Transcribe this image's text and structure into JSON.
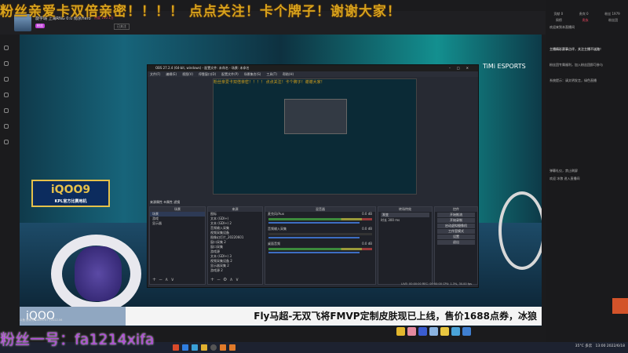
{
  "banner": "粉丝亲爱卡双倍亲密！！！！ 点点关注！卡个牌子！谢谢大家！",
  "header": {
    "streamer": "旋学璐 上海RNG 0:0 南京Hero",
    "hot": "热度 140.1万",
    "fans_badge": "粉丝",
    "subscribe": "已关注"
  },
  "sidebar": {
    "icons": [
      "home-icon",
      "follow-icon",
      "category-icon",
      "game-icon",
      "live-icon",
      "video-icon",
      "more-icon"
    ]
  },
  "video": {
    "sponsor": "iQOO9",
    "sponsor_sub": "KPL官方比赛用机",
    "esports_logo": "TiMi ESPORTS",
    "ticker": "Fly马超-无双飞将FMVP定制皮肤现已上线，售价1688点券，冰狼",
    "iqoo_corner": "iQOO",
    "room_info": "斗鱼 房间号: 1863767 | 2022.06"
  },
  "obs": {
    "title": "OBS 27.2.4 (64-bit, windows) - 配置文件: 未命名 - 场景: 未命名",
    "menu": [
      "文件(F)",
      "编辑(E)",
      "视图(V)",
      "停靠窗口(D)",
      "配置文件(P)",
      "场景集合(S)",
      "工具(T)",
      "帮助(H)"
    ],
    "scene_bar": "来源属性   ⚙属性   滤镜",
    "docks": {
      "scenes": "场景",
      "sources": "来源",
      "mixer": "混音器",
      "transitions": "转场特效",
      "controls": "控件"
    },
    "scenes": [
      "场景",
      "游戏",
      "显示器"
    ],
    "sources": [
      "图标",
      "文本 (GDI+)",
      "文本 (GDI+) 2",
      "音频输入采集",
      "视频采集设备",
      "图像幻灯片_20220601",
      "窗口采集 2",
      "窗口采集",
      "游戏源",
      "文本 (GDI+) 3",
      "视频采集设备 2",
      "显示器采集 2",
      "游戏源 2"
    ],
    "mixer": [
      {
        "name": "麦克风/Aux",
        "db": "0.0 dB"
      },
      {
        "name": "音频输入采集",
        "db": "0.0 dB"
      },
      {
        "name": "桌面音频",
        "db": "0.0 dB"
      }
    ],
    "transition": {
      "type": "渐变",
      "duration_label": "时长",
      "duration": "300 ms"
    },
    "controls": [
      "开始推流",
      "开始录制",
      "启动虚拟摄像机",
      "工作室模式",
      "设置",
      "退出"
    ],
    "status": "LIVE: 00:00:00   REC: 00:00:00   CPU: 1.3%, 30.00 fps"
  },
  "chat": {
    "tabs": [
      "贡献",
      "贵宾",
      "粉丝"
    ],
    "counts": [
      "0",
      "0",
      "1979"
    ],
    "rank_tabs": [
      "周榜",
      "贵族",
      "粉丝团"
    ],
    "messages": [
      "欢迎来到本直播间",
      "主播精彩赛事点评，关注主播不迷路！",
      "粉丝团专属福利，加入粉丝团即可参与",
      "系统提示：请文明发言，绿色直播",
      "弹幕礼仪，禁止刷屏",
      "欢迎 冰狼 进入直播间"
    ]
  },
  "overlay": {
    "fan_id": "粉丝一号：fa1214xifa"
  },
  "taskbar": {
    "weather": "35°C 多云",
    "time": "13:00",
    "date": "2022/6/18"
  }
}
